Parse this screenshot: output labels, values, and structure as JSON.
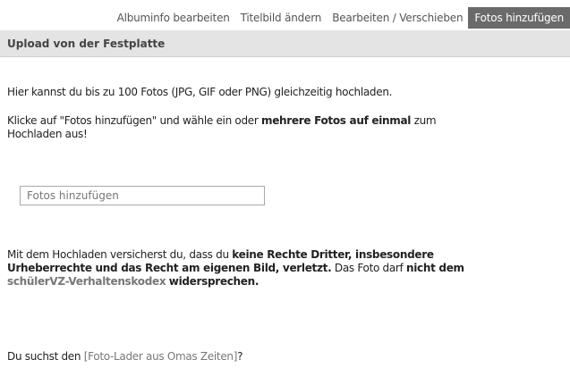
{
  "tabs": [
    {
      "label": "Albuminfo bearbeiten",
      "active": false
    },
    {
      "label": "Titelbild ändern",
      "active": false
    },
    {
      "label": "Bearbeiten / Verschieben",
      "active": false
    },
    {
      "label": "Fotos hinzufügen",
      "active": true
    }
  ],
  "section": {
    "title": "Upload von der Festplatte"
  },
  "intro": "Hier kannst du bis zu 100 Fotos (JPG, GIF oder PNG) gleichzeitig hochladen.",
  "instruction": {
    "pre": "Klicke auf \"Fotos hinzufügen\" und wähle ein oder ",
    "bold": "mehrere Fotos auf einmal",
    "post": " zum Hochladen aus!"
  },
  "upload_field": {
    "placeholder": "Fotos hinzufügen"
  },
  "legal": {
    "part1": "Mit dem Hochladen versicherst du, dass du ",
    "bold1": "keine Rechte Dritter, insbesondere Urheberrechte und das Recht am eigenen Bild, verletzt.",
    "part2": " Das Foto darf ",
    "bold2": "nicht dem",
    "link": "schülerVZ-Verhaltenskodex",
    "bold3": "widersprechen."
  },
  "footer": {
    "pre": "Du suchst den ",
    "bracket_open": "[",
    "link": "Foto-Lader aus Omas Zeiten",
    "bracket_close": "]",
    "post": "?"
  },
  "colors": {
    "active_tab_bg": "#6a6a6a",
    "header_bg": "#e4e4e4",
    "link": "#777777"
  }
}
